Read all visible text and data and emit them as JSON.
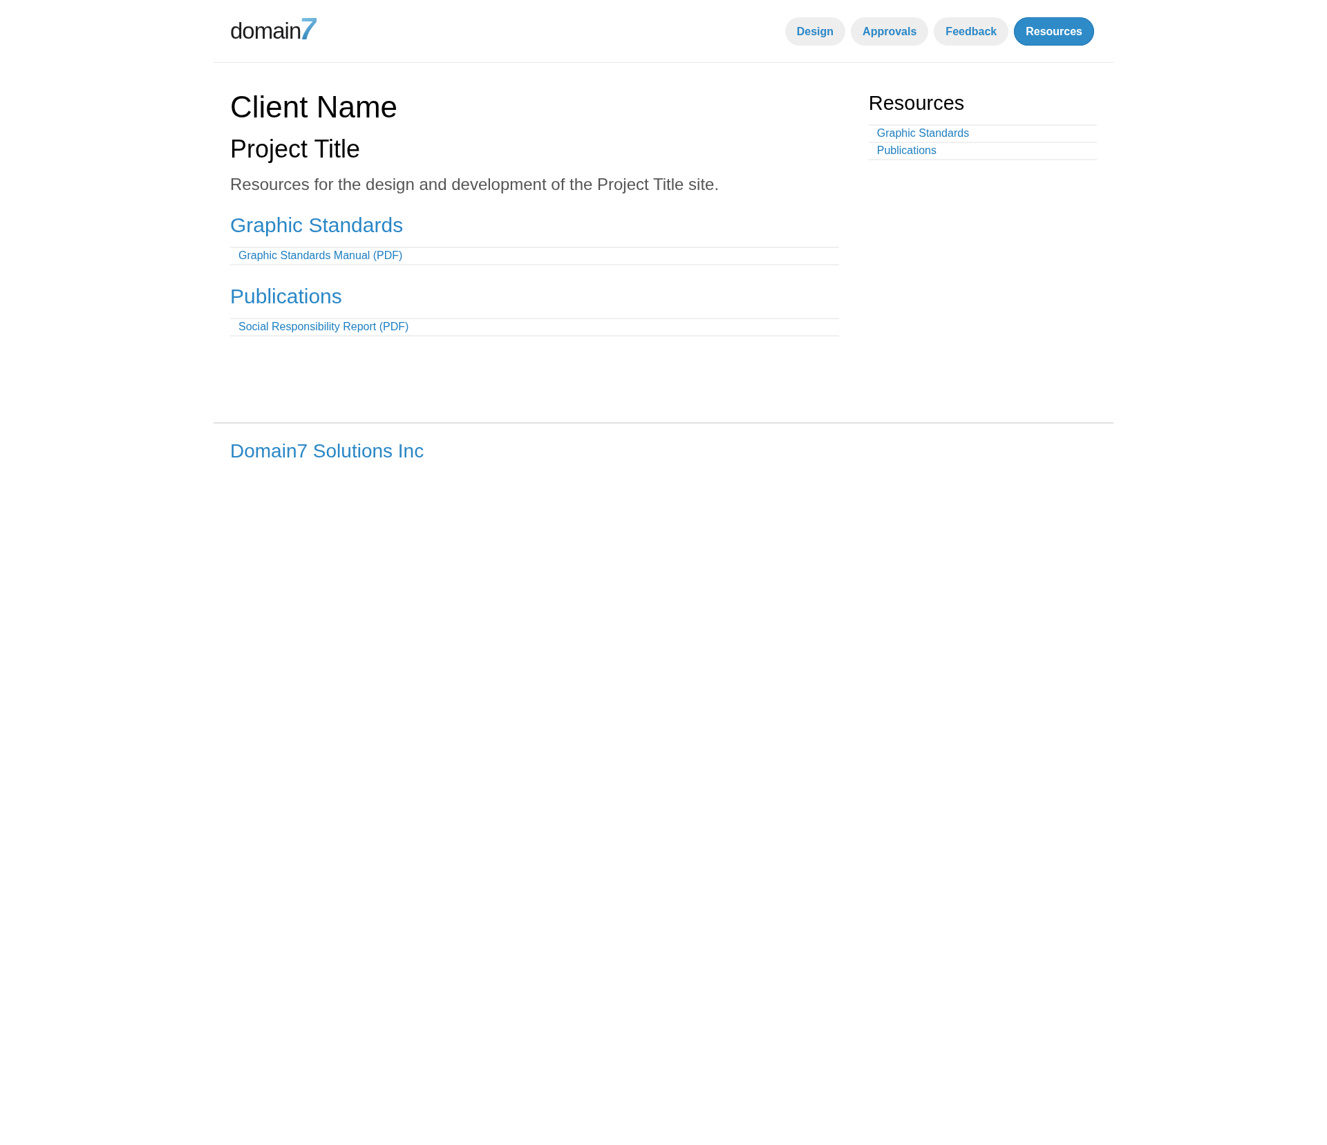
{
  "header": {
    "logo": {
      "text": "domain",
      "mark": "7"
    },
    "nav": [
      {
        "label": "Design",
        "selected": false
      },
      {
        "label": "Approvals",
        "selected": false
      },
      {
        "label": "Feedback",
        "selected": false
      },
      {
        "label": "Resources",
        "selected": true
      }
    ]
  },
  "main": {
    "client": "Client Name",
    "project": "Project Title",
    "intro": "Resources for the design and development of the Project Title site.",
    "sections": [
      {
        "heading": "Graphic Standards",
        "links": [
          "Graphic Standards Manual (PDF)"
        ]
      },
      {
        "heading": "Publications",
        "links": [
          "Social Responsibility Report (PDF)"
        ]
      }
    ]
  },
  "sidebar": {
    "heading": "Resources",
    "links": [
      "Graphic Standards",
      "Publications"
    ]
  },
  "footer": {
    "text": "Domain7 Solutions Inc"
  }
}
